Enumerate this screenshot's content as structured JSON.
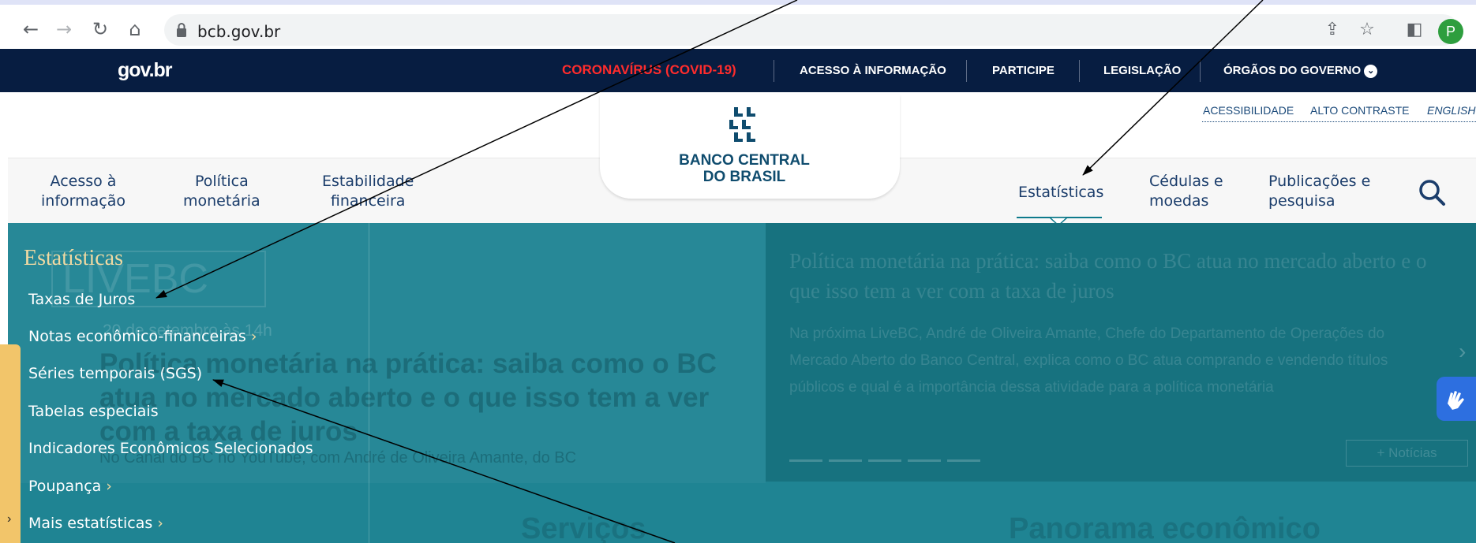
{
  "browser": {
    "back_icon": "back-arrow-icon",
    "forward_icon": "forward-arrow-icon",
    "reload_icon": "reload-icon",
    "home_icon": "home-icon",
    "url": "bcb.gov.br",
    "profile_initial": "P"
  },
  "govbar": {
    "logo": "gov.br",
    "links": [
      "CORONAVÍRUS (COVID-19)",
      "ACESSO À INFORMAÇÃO",
      "PARTICIPE",
      "LEGISLAÇÃO",
      "ÓRGÃOS DO GOVERNO"
    ],
    "covid_color": "#ff2c2c"
  },
  "accessibility": {
    "links": [
      "ACESSIBILIDADE",
      "ALTO CONTRASTE",
      "ENGLISH"
    ]
  },
  "brand": {
    "name_line1": "BANCO CENTRAL",
    "name_line2": "DO BRASIL",
    "color": "#0f4c6e"
  },
  "nav": {
    "items": [
      {
        "line1": "Acesso à",
        "line2": "informação"
      },
      {
        "line1": "Política",
        "line2": "monetária"
      },
      {
        "line1": "Estabilidade",
        "line2": "financeira"
      },
      {
        "line1": "Estatísticas",
        "line2": ""
      },
      {
        "line1": "Cédulas e",
        "line2": "moedas"
      },
      {
        "line1": "Publicações e",
        "line2": "pesquisa"
      }
    ],
    "active": "Estatísticas"
  },
  "menu": {
    "title": "Estatísticas",
    "items": [
      {
        "label": "Taxas de Juros",
        "submenu": false
      },
      {
        "label": "Notas econômico-financeiras",
        "submenu": true
      },
      {
        "label": "Séries temporais (SGS)",
        "submenu": false
      },
      {
        "label": "Tabelas especiais",
        "submenu": false
      },
      {
        "label": "Indicadores Econômicos Selecionados",
        "submenu": false
      },
      {
        "label": "Poupança",
        "submenu": true
      },
      {
        "label": "Mais estatísticas",
        "submenu": true
      }
    ],
    "arrow": "›"
  },
  "background": {
    "live_logo": "LIVEBC",
    "date": "20 de setembro às 14h",
    "title": "Política monetária na prática: saiba como o BC atua no mercado aberto e o que isso tem a ver com a taxa de juros",
    "subtitle": "No Canal do BC no YouTube, com André de Oliveira Amante, do BC",
    "slide_title": "Política monetária na prática: saiba como o BC atua no mercado aberto e o que isso tem a ver com a taxa de juros",
    "slide_text": "Na próxima LiveBC, André de Oliveira Amante, Chefe do Departamento de Operações do Mercado Aberto do Banco Central, explica como o BC atua comprando e vendendo títulos públicos e qual é a importância dessa atividade para a política monetária",
    "news_button": "+ Notícias",
    "section_left": "Serviços",
    "section_right": "Panorama econômico"
  },
  "colors": {
    "gov_navy": "#071d41",
    "teal": "#1f8493",
    "menu_title": "#f0d9a2"
  }
}
